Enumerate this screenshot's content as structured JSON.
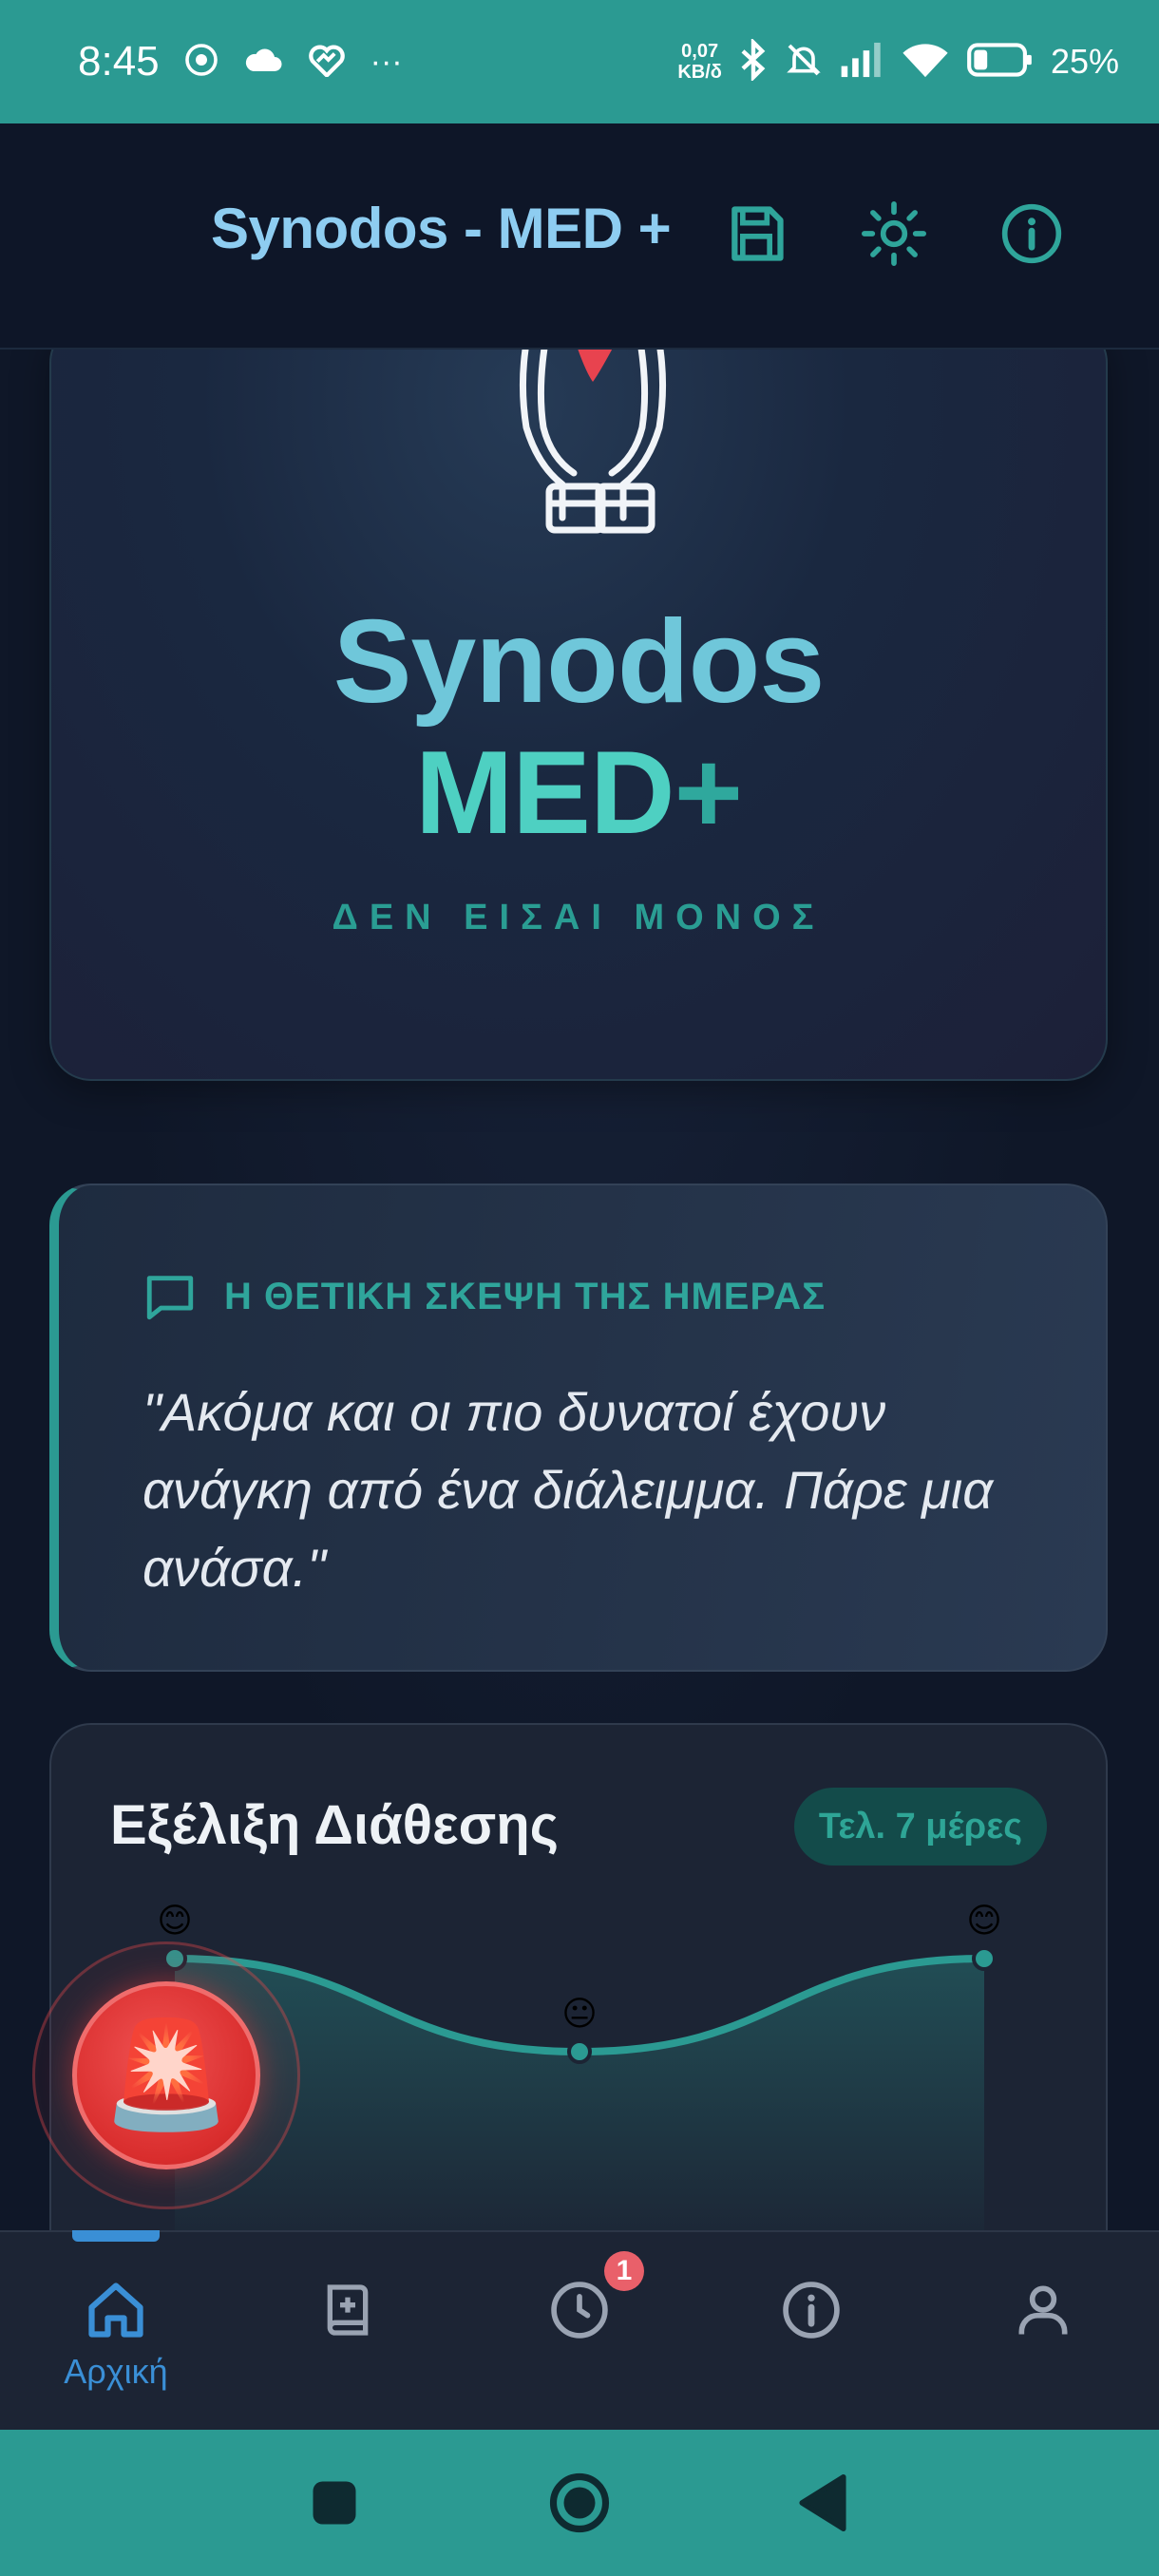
{
  "status_bar": {
    "time": "8:45",
    "net_speed_value": "0,07",
    "net_speed_unit": "KB/δ",
    "battery": "25%"
  },
  "header": {
    "title": "Synodos - MED +",
    "icons": [
      "save-icon",
      "sun-icon",
      "info-icon"
    ]
  },
  "hero": {
    "title_line1": "Synodos",
    "title_line2_main": "MED",
    "title_line2_plus": "+",
    "subtitle": "ΔΕΝ ΕΙΣΑΙ ΜΟΝΟΣ"
  },
  "quote": {
    "label": "Η ΘΕΤΙΚΗ ΣΚΕΨΗ ΤΗΣ ΗΜΕΡΑΣ",
    "text": "\"Ακόμα και οι πιο δυνατοί έχουν ανάγκη από ένα διάλειμμα. Πάρε μια ανάσα.\""
  },
  "mood": {
    "title": "Εξέλιξη Διάθεσης",
    "badge": "Τελ. 7 μέρες"
  },
  "chart_data": {
    "type": "line",
    "x": [
      1,
      2,
      3
    ],
    "values": [
      2,
      1,
      2
    ],
    "point_emojis": [
      "😊",
      "😐",
      "😊"
    ],
    "ylim": [
      0,
      2
    ],
    "grid": false,
    "title": "",
    "xlabel": "",
    "ylabel": ""
  },
  "sos": {
    "emoji": "🚨"
  },
  "bottom_nav": {
    "items": [
      {
        "label": "Αρχική",
        "icon": "home-icon",
        "active": true
      },
      {
        "label": "",
        "icon": "medical-book-icon",
        "active": false
      },
      {
        "label": "",
        "icon": "clock-icon",
        "active": false
      },
      {
        "label": "",
        "icon": "info-icon",
        "active": false
      },
      {
        "label": "",
        "icon": "profile-icon",
        "active": false
      }
    ],
    "history_badge": "1"
  },
  "colors": {
    "status_bar": "#2b9a92",
    "accent_teal": "#2fa59b",
    "accent_blue": "#3a8fd6",
    "sos_red": "#d92d2d",
    "background": "#0f1728"
  }
}
